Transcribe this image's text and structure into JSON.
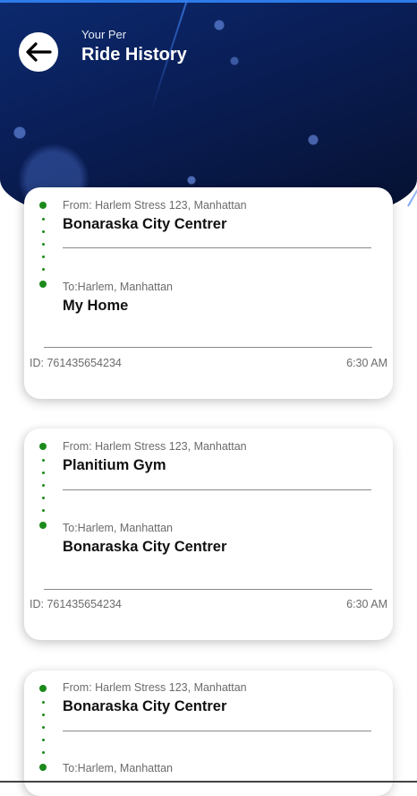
{
  "header": {
    "subtitle": "Your Per",
    "title": "Ride History",
    "back_icon": "arrow-left-icon",
    "accent_color": "#2d7be8"
  },
  "rides": [
    {
      "from_label": "From: Harlem Stress 123, Manhattan",
      "from_place": "Bonaraska City Centrer",
      "to_label": "To:Harlem, Manhattan",
      "to_place": "My Home",
      "id": "ID: 761435654234",
      "time": "6:30 AM"
    },
    {
      "from_label": "From: Harlem Stress 123, Manhattan",
      "from_place": "Planitium Gym",
      "to_label": "To:Harlem, Manhattan",
      "to_place": "Bonaraska City Centrer",
      "id": "ID: 761435654234",
      "time": "6:30 AM"
    },
    {
      "from_label": "From: Harlem Stress 123, Manhattan",
      "from_place": "Bonaraska City Centrer",
      "to_label": "To:Harlem, Manhattan"
    }
  ],
  "colors": {
    "route_dot": "#1b8a1b",
    "header_bg": "#0a1f5a"
  }
}
